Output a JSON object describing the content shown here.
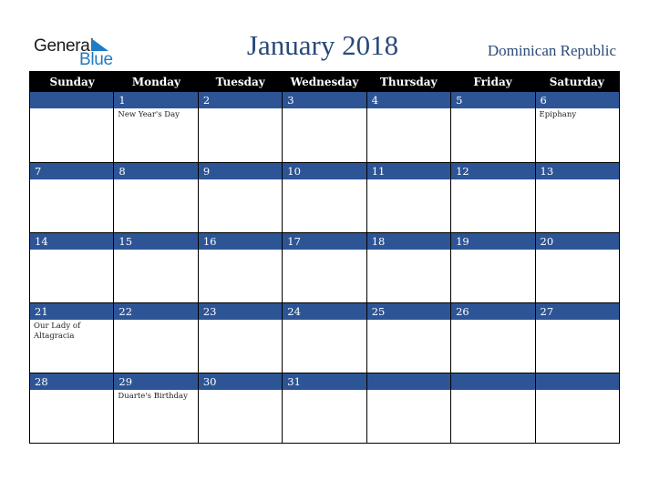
{
  "logo": {
    "word1": "General",
    "word2": "Blue",
    "icon": "triangle-flag-icon"
  },
  "header": {
    "title": "January 2018",
    "country": "Dominican Republic"
  },
  "colors": {
    "title": "#2a4a78",
    "band": "#2d5596",
    "header_bg": "#000000",
    "logo_blue": "#1e7bc4"
  },
  "weekdays": [
    "Sunday",
    "Monday",
    "Tuesday",
    "Wednesday",
    "Thursday",
    "Friday",
    "Saturday"
  ],
  "weeks": [
    [
      {
        "day": "",
        "event": ""
      },
      {
        "day": "1",
        "event": "New Year's Day"
      },
      {
        "day": "2",
        "event": ""
      },
      {
        "day": "3",
        "event": ""
      },
      {
        "day": "4",
        "event": ""
      },
      {
        "day": "5",
        "event": ""
      },
      {
        "day": "6",
        "event": "Epiphany"
      }
    ],
    [
      {
        "day": "7",
        "event": ""
      },
      {
        "day": "8",
        "event": ""
      },
      {
        "day": "9",
        "event": ""
      },
      {
        "day": "10",
        "event": ""
      },
      {
        "day": "11",
        "event": ""
      },
      {
        "day": "12",
        "event": ""
      },
      {
        "day": "13",
        "event": ""
      }
    ],
    [
      {
        "day": "14",
        "event": ""
      },
      {
        "day": "15",
        "event": ""
      },
      {
        "day": "16",
        "event": ""
      },
      {
        "day": "17",
        "event": ""
      },
      {
        "day": "18",
        "event": ""
      },
      {
        "day": "19",
        "event": ""
      },
      {
        "day": "20",
        "event": ""
      }
    ],
    [
      {
        "day": "21",
        "event": "Our Lady of Altagracia"
      },
      {
        "day": "22",
        "event": ""
      },
      {
        "day": "23",
        "event": ""
      },
      {
        "day": "24",
        "event": ""
      },
      {
        "day": "25",
        "event": ""
      },
      {
        "day": "26",
        "event": ""
      },
      {
        "day": "27",
        "event": ""
      }
    ],
    [
      {
        "day": "28",
        "event": ""
      },
      {
        "day": "29",
        "event": "Duarte's Birthday"
      },
      {
        "day": "30",
        "event": ""
      },
      {
        "day": "31",
        "event": ""
      },
      {
        "day": "",
        "event": ""
      },
      {
        "day": "",
        "event": ""
      },
      {
        "day": "",
        "event": ""
      }
    ]
  ]
}
